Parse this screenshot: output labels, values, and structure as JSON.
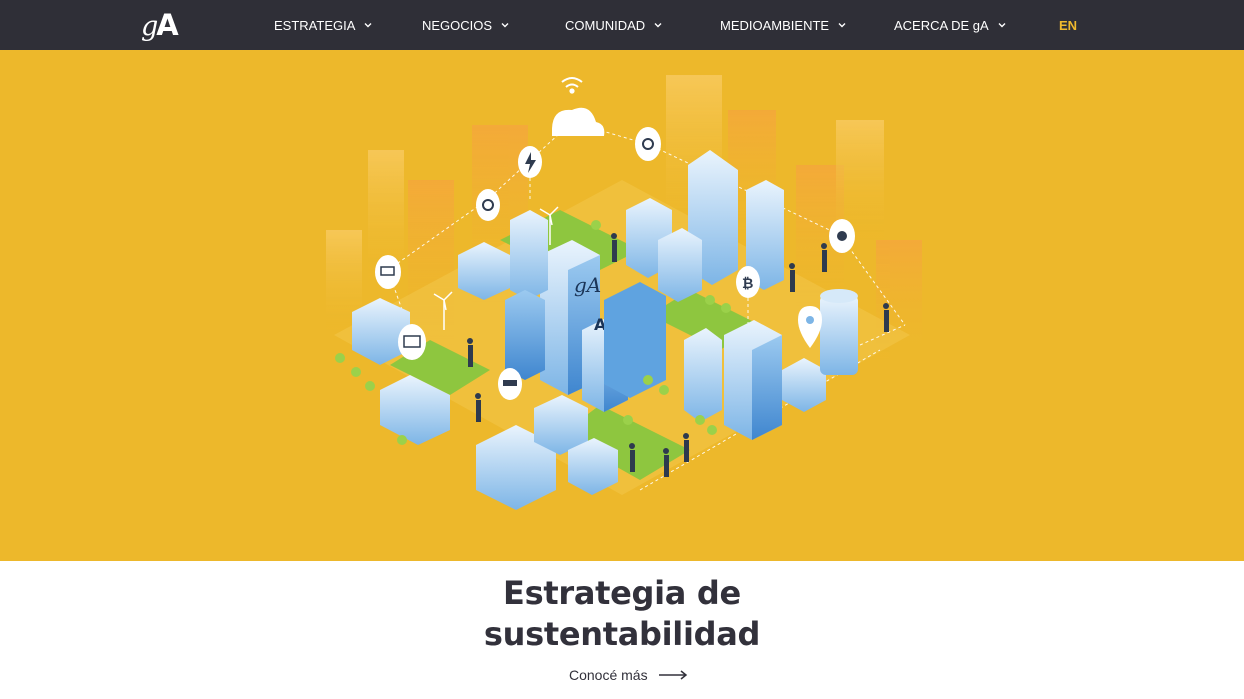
{
  "header": {
    "logo_text_g": "g",
    "logo_text_a": "A",
    "nav": [
      {
        "label": "ESTRATEGIA"
      },
      {
        "label": "NEGOCIOS"
      },
      {
        "label": "COMUNIDAD"
      },
      {
        "label": "MEDIOAMBIENTE"
      },
      {
        "label": "ACERCA DE gA"
      }
    ],
    "language": "EN"
  },
  "hero": {
    "background": "#edb82b",
    "building_logo_1": "gA",
    "building_logo_2": "A"
  },
  "content": {
    "title_line1": "Estrategia de",
    "title_line2": "sustentabilidad",
    "cta_label": "Conocé más"
  },
  "colors": {
    "nav_bg": "#2f2f37",
    "accent_yellow": "#f0b92d",
    "text_dark": "#32313b"
  }
}
